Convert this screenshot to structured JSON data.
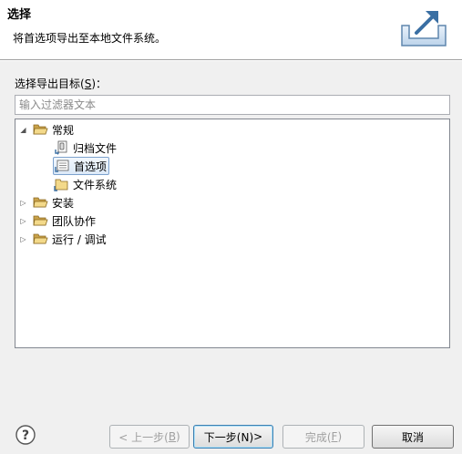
{
  "header": {
    "title": "选择",
    "description": "将首选项导出至本地文件系统。",
    "icon": "export-wizard-icon"
  },
  "target": {
    "label_prefix": "选择导出目标(",
    "label_mnemonic": "S",
    "label_suffix": ")："
  },
  "filter": {
    "placeholder": "输入过滤器文本",
    "value": ""
  },
  "tree": {
    "nodes": [
      {
        "label": "常规",
        "expanded": true,
        "icon": "folder-open-icon"
      },
      {
        "label": "归档文件",
        "icon": "archive-file-icon"
      },
      {
        "label": "首选项",
        "icon": "preferences-icon",
        "selected": true
      },
      {
        "label": "文件系统",
        "icon": "folder-icon"
      },
      {
        "label": "安装",
        "expanded": false,
        "icon": "folder-icon"
      },
      {
        "label": "团队协作",
        "expanded": false,
        "icon": "folder-icon"
      },
      {
        "label": "运行 / 调试",
        "expanded": false,
        "icon": "folder-icon"
      }
    ]
  },
  "buttons": {
    "back_prefix": "< 上一步(",
    "back_mnemonic": "B",
    "back_suffix": ")",
    "next_prefix": "下一步(N)",
    "next_suffix": " >",
    "finish_prefix": "完成(",
    "finish_mnemonic": "F",
    "finish_suffix": ")",
    "cancel": "取消"
  },
  "help_icon": "help-icon"
}
